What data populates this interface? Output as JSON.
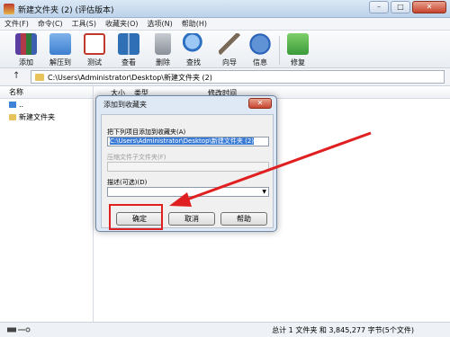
{
  "window": {
    "title": "新建文件夹 (2) (评估版本)",
    "minimize": "–",
    "maximize": "□",
    "close": "✕"
  },
  "menu": [
    "文件(F)",
    "命令(C)",
    "工具(S)",
    "收藏夹(O)",
    "选项(N)",
    "帮助(H)"
  ],
  "toolbar": [
    {
      "label": "添加",
      "icon": "archive-add-icon",
      "color": "#b23a48"
    },
    {
      "label": "解压到",
      "icon": "folder-extract-icon",
      "color": "#3d7fd0"
    },
    {
      "label": "测试",
      "icon": "checklist-icon",
      "color": "#c0392b"
    },
    {
      "label": "查看",
      "icon": "book-icon",
      "color": "#2f6fb5"
    },
    {
      "label": "删除",
      "icon": "trash-icon",
      "color": "#8a9099"
    },
    {
      "label": "查找",
      "icon": "magnifier-icon",
      "color": "#2c6fc2"
    },
    {
      "label": "向导",
      "icon": "wand-icon",
      "color": "#7a6a5a"
    },
    {
      "label": "信息",
      "icon": "info-icon",
      "color": "#2a63b8"
    },
    {
      "label": "修复",
      "icon": "repair-icon",
      "color": "#3a9a3a"
    }
  ],
  "address": {
    "path": "C:\\Users\\Administrator\\Desktop\\新建文件夹 (2)"
  },
  "sidebar": {
    "header": "名称",
    "items": [
      "..",
      "新建文件夹"
    ]
  },
  "filelist": {
    "columns": [
      "大小",
      "类型",
      "修改时间"
    ]
  },
  "status": {
    "text": "总计 1 文件夹 和 3,845,277 字节(5个文件)"
  },
  "dialog": {
    "title": "添加到收藏夹",
    "close": "✕",
    "field1_label": "把下列项目添加到收藏夹(A)",
    "field1_value": "C:\\Users\\Administrator\\Desktop\\新建文件夹 (2)",
    "field2_label": "压缩文件子文件夹(F)",
    "field3_label": "描述(可选)(D)",
    "ok": "确定",
    "cancel": "取消",
    "help": "帮助"
  },
  "colors": {
    "highlight": "#e02020",
    "selection": "#3a7bd5"
  }
}
